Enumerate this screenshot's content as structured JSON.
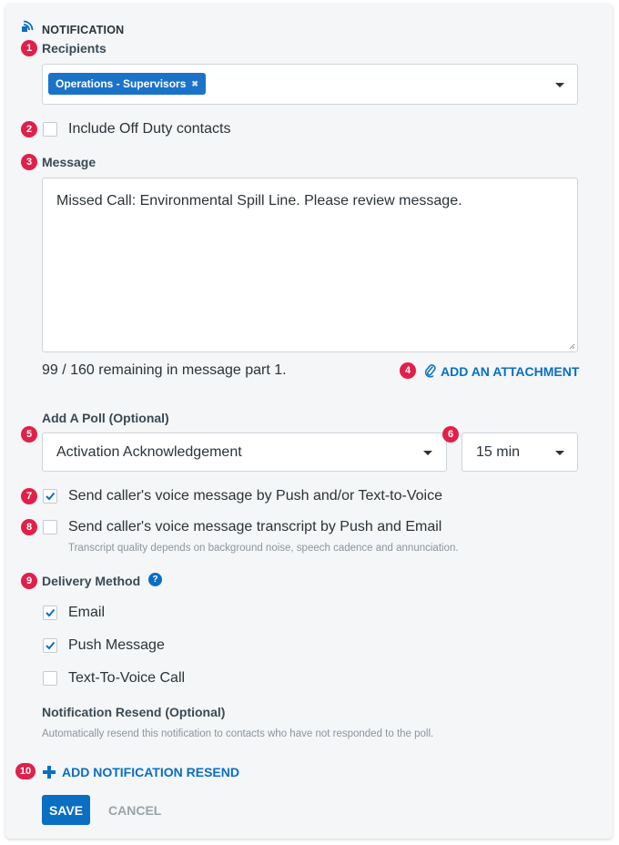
{
  "header": {
    "title": "NOTIFICATION",
    "icon": "broadcast-icon"
  },
  "recipients": {
    "badge": "1",
    "label": "Recipients",
    "tag": "Operations - Supervisors",
    "tag_remove": "✖"
  },
  "off_duty": {
    "badge": "2",
    "label": "Include Off Duty contacts",
    "checked": false
  },
  "message": {
    "badge": "3",
    "label": "Message",
    "value": "Missed Call: Environmental Spill Line. Please review message.",
    "remaining": "99 / 160 remaining in message part 1."
  },
  "attachment": {
    "badge": "4",
    "label": "ADD AN ATTACHMENT",
    "icon": "paperclip-icon"
  },
  "poll": {
    "badge": "5",
    "label": "Add A Poll (Optional)",
    "selected": "Activation Acknowledgement"
  },
  "poll_timeout": {
    "badge": "6",
    "selected": "15 min"
  },
  "voice_push": {
    "badge": "7",
    "label": "Send caller's voice message by Push and/or Text-to-Voice",
    "checked": true
  },
  "transcript": {
    "badge": "8",
    "label": "Send caller's voice message transcript by Push and Email",
    "hint": "Transcript quality depends on background noise, speech cadence and annunciation.",
    "checked": false
  },
  "delivery": {
    "badge": "9",
    "label": "Delivery Method",
    "help_icon": "question-icon",
    "help_glyph": "?",
    "options": [
      {
        "label": "Email",
        "checked": true
      },
      {
        "label": "Push Message",
        "checked": true
      },
      {
        "label": "Text-To-Voice Call",
        "checked": false
      }
    ]
  },
  "resend": {
    "label": "Notification Resend (Optional)",
    "hint": "Automatically resend this notification to contacts who have not responded to the poll.",
    "badge": "10",
    "add_label": "ADD NOTIFICATION RESEND"
  },
  "actions": {
    "save": "SAVE",
    "cancel": "CANCEL"
  },
  "colors": {
    "accent": "#0a6ec2",
    "badge": "#e0204a",
    "tag": "#1a73c9"
  }
}
